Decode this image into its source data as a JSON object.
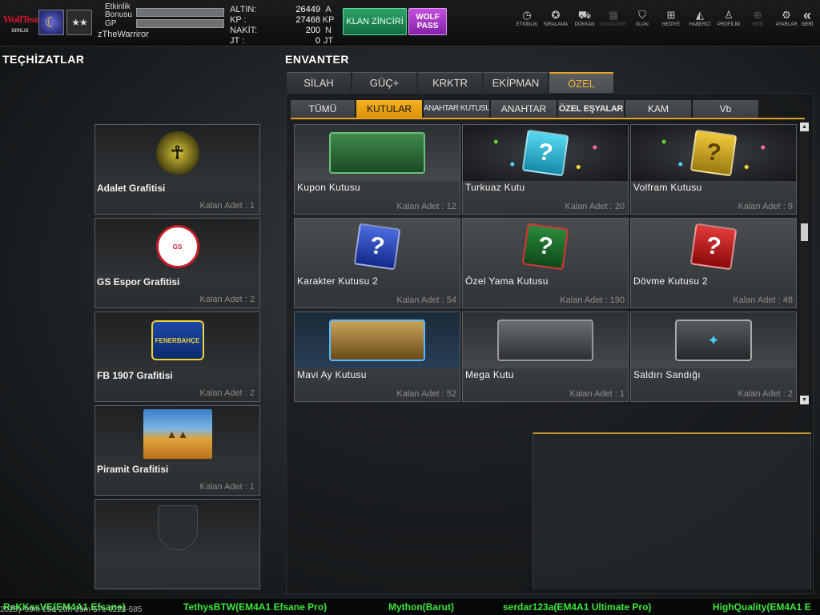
{
  "topbar": {
    "logo_text": "WolfTeam",
    "logo_sub": "DIRILIS",
    "rank_stars": "★★",
    "bonus_label": "Etkinlik Bonusu",
    "gp_label": "GP",
    "username": "zTheWarriror",
    "currency": [
      {
        "label": "ALTIN:",
        "value": "26449",
        "unit": "A"
      },
      {
        "label": "KP :",
        "value": "27468",
        "unit": "KP"
      },
      {
        "label": "NAKİT:",
        "value": "200",
        "unit": "N"
      },
      {
        "label": "JT :",
        "value": "0",
        "unit": "JT"
      }
    ],
    "clan_button": "KLAN ZİNCİRİ",
    "wolfpass_line1": "WOLF",
    "wolfpass_line2": "PASS",
    "nav": [
      {
        "label": "ETKİNLİK",
        "icon": "stopwatch-icon",
        "glyph": "◷"
      },
      {
        "label": "SIRALAMA",
        "icon": "medal-icon",
        "glyph": "✪"
      },
      {
        "label": "DÜKKAN",
        "icon": "cart-icon",
        "glyph": "⛟"
      },
      {
        "label": "ENVANTER",
        "icon": "inventory-icon",
        "glyph": "▦"
      },
      {
        "label": "KLAN",
        "icon": "shield-icon",
        "glyph": "⛉"
      },
      {
        "label": "HEDİYE",
        "icon": "gift-icon",
        "glyph": "⊞"
      },
      {
        "label": "HABERCİ",
        "icon": "megaphone-icon",
        "glyph": "◭"
      },
      {
        "label": "PROFİLİM",
        "icon": "profile-icon",
        "glyph": "♙"
      },
      {
        "label": "WEB",
        "icon": "globe-icon",
        "glyph": "⊕"
      },
      {
        "label": "AYARLAR",
        "icon": "gear-icon",
        "glyph": "⚙"
      }
    ],
    "back_label": "GERİ"
  },
  "left": {
    "title": "TEÇHİZATLAR",
    "cards": [
      {
        "name": "Adalet Grafitisi",
        "qty": "Kalan Adet : 1",
        "emblem": "☥"
      },
      {
        "name": "GS Espor Grafitisi",
        "qty": "Kalan Adet : 2",
        "emblem": "GS"
      },
      {
        "name": "FB 1907 Grafitisi",
        "qty": "Kalan Adet : 2",
        "emblem": "FENERBAHÇE"
      },
      {
        "name": "Piramit Grafitisi",
        "qty": "Kalan Adet : 1",
        "emblem": "▲▲"
      }
    ]
  },
  "inventory": {
    "title": "ENVANTER",
    "main_tabs": [
      "SİLAH",
      "GÜÇ+",
      "KRKTR",
      "EKİPMAN",
      "ÖZEL"
    ],
    "active_main_tab": 4,
    "sub_tabs": [
      "TÜMÜ",
      "KUTULAR",
      "ANAHTAR KUTUSU",
      "ANAHTAR",
      "ÖZEL EŞYALAR",
      "KAM",
      "Vb"
    ],
    "active_sub_tab": 1,
    "items": [
      {
        "name": "Kupon Kutusu",
        "qty": "Kalan Adet : 12"
      },
      {
        "name": "Turkuaz Kutu",
        "qty": "Kalan Adet : 20"
      },
      {
        "name": "Volfram Kutusu",
        "qty": "Kalan Adet : 9"
      },
      {
        "name": "Karakter Kutusu 2",
        "qty": "Kalan Adet : 54"
      },
      {
        "name": "Özel Yama Kutusu",
        "qty": "Kalan Adet : 190"
      },
      {
        "name": "Dövme Kutusu 2",
        "qty": "Kalan Adet : 48"
      },
      {
        "name": "Mavi Ay Kutusu",
        "qty": "Kalan Adet : 52"
      },
      {
        "name": "Mega Kutu",
        "qty": "Kalan Adet : 1"
      },
      {
        "name": "Saldırı Sandığı",
        "qty": "Kalan Adet : 2"
      }
    ],
    "box_glyph": "?"
  },
  "ticker": {
    "entries": [
      "RaKKasVE(EM4A1 Efsane)",
      "TethysBTW(EM4A1 Efsane Pro)",
      "Mython(Barut)",
      "serdar123a(EM4A1 Ultimate Pro)",
      "HighQuality(EM4A1 E"
    ],
    "datestamp": "2025y-09m-25d-20h-39m-57s 0228-685"
  },
  "colors": {
    "accent": "#e3a21c",
    "ticker_green": "#39e838",
    "clan_green": "#2ea46a",
    "wolfpass_purple": "#c44fe0"
  }
}
